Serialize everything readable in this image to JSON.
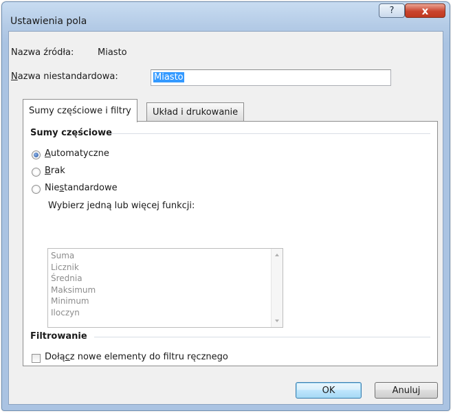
{
  "window": {
    "title": "Ustawienia pola",
    "help_icon": "?",
    "close_icon": "x"
  },
  "source": {
    "label": "Nazwa źródła:",
    "value": "Miasto"
  },
  "custom_name": {
    "label_mnemonic": "N",
    "label_rest": "azwa niestandardowa:",
    "value": "Miasto"
  },
  "tabs": [
    {
      "label": "Sumy częściowe i filtry",
      "active": true
    },
    {
      "label": "Układ i drukowanie",
      "active": false
    }
  ],
  "subtotals": {
    "section_title": "Sumy częściowe",
    "options": [
      {
        "pre": "",
        "mnemonic": "A",
        "post": "utomatyczne",
        "checked": true
      },
      {
        "pre": "",
        "mnemonic": "B",
        "post": "rak",
        "checked": false
      },
      {
        "pre": "Nie",
        "mnemonic": "s",
        "post": "tandardowe",
        "checked": false
      }
    ],
    "functions_label": "Wybierz jedną lub więcej funkcji:",
    "functions": [
      "Suma",
      "Licznik",
      "Średnia",
      "Maksimum",
      "Minimum",
      "Iloczyn"
    ]
  },
  "filter": {
    "section_title": "Filtrowanie",
    "checkbox_pre": "Dołą",
    "checkbox_mnemonic": "c",
    "checkbox_post": "z nowe elementy do filtru ręcznego",
    "checked": false
  },
  "buttons": {
    "ok": "OK",
    "cancel": "Anuluj"
  },
  "colors": {
    "selection": "#3399ff",
    "close_button": "#c9442e",
    "titlebar": "#b4cbe6"
  }
}
